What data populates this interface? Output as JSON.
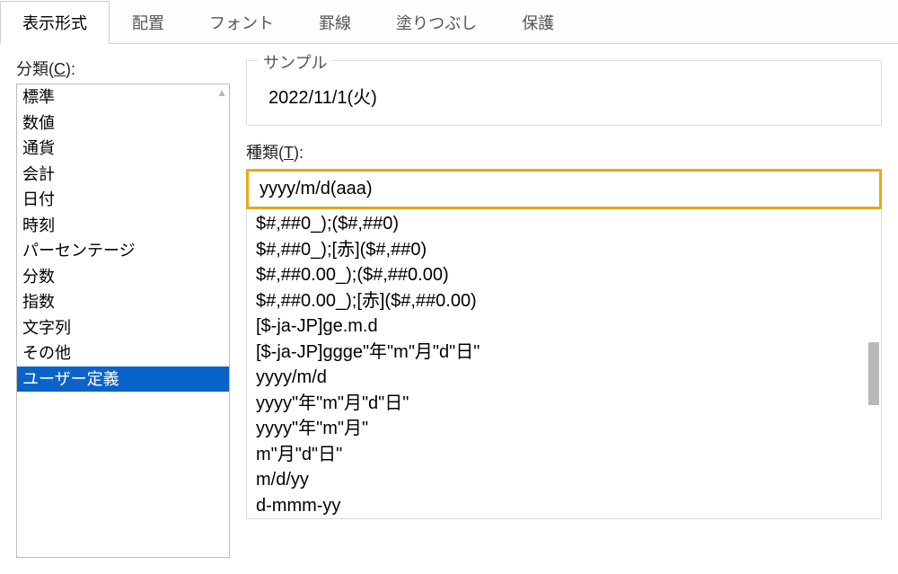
{
  "tabs": [
    {
      "label": "表示形式",
      "active": true
    },
    {
      "label": "配置",
      "active": false
    },
    {
      "label": "フォント",
      "active": false
    },
    {
      "label": "罫線",
      "active": false
    },
    {
      "label": "塗りつぶし",
      "active": false
    },
    {
      "label": "保護",
      "active": false
    }
  ],
  "category_label_prefix": "分類(",
  "category_label_key": "C",
  "category_label_suffix": "):",
  "categories": [
    {
      "label": "標準",
      "selected": false
    },
    {
      "label": "数値",
      "selected": false
    },
    {
      "label": "通貨",
      "selected": false
    },
    {
      "label": "会計",
      "selected": false
    },
    {
      "label": "日付",
      "selected": false
    },
    {
      "label": "時刻",
      "selected": false
    },
    {
      "label": "パーセンテージ",
      "selected": false
    },
    {
      "label": "分数",
      "selected": false
    },
    {
      "label": "指数",
      "selected": false
    },
    {
      "label": "文字列",
      "selected": false
    },
    {
      "label": "その他",
      "selected": false
    },
    {
      "label": "ユーザー定義",
      "selected": true
    }
  ],
  "sample": {
    "legend": "サンプル",
    "value": "2022/11/1(火)"
  },
  "type_label_prefix": "種類(",
  "type_label_key": "T",
  "type_label_suffix": "):",
  "type_input_value": "yyyy/m/d(aaa)",
  "type_list": [
    "$#,##0_);($#,##0)",
    "$#,##0_);[赤]($#,##0)",
    "$#,##0.00_);($#,##0.00)",
    "$#,##0.00_);[赤]($#,##0.00)",
    "[$-ja-JP]ge.m.d",
    "[$-ja-JP]ggge\"年\"m\"月\"d\"日\"",
    "yyyy/m/d",
    "yyyy\"年\"m\"月\"d\"日\"",
    "yyyy\"年\"m\"月\"",
    "m\"月\"d\"日\"",
    "m/d/yy",
    "d-mmm-yy"
  ]
}
